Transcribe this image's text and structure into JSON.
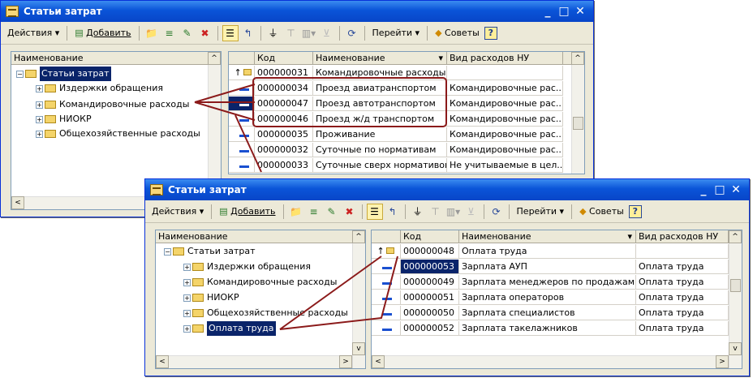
{
  "window1": {
    "title": "Статьи затрат",
    "toolbar": {
      "actions": "Действия",
      "add": "Добавить",
      "goto": "Перейти",
      "tips": "Советы",
      "help": "?"
    },
    "tree": {
      "header": "Наименование",
      "root": "Статьи затрат",
      "items": [
        "Издержки обращения",
        "Командировочные расходы",
        "НИОКР",
        "Общехозяйственные расходы"
      ]
    },
    "grid": {
      "headers": [
        "Код",
        "Наименование",
        "Вид расходов НУ"
      ],
      "parent": {
        "code": "000000031",
        "name": "Командировочные расходы"
      },
      "rows": [
        {
          "code": "000000034",
          "name": "Проезд авиатранспортом",
          "kind": "Командировочные рас..."
        },
        {
          "code": "000000047",
          "name": "Проезд автотранспортом",
          "kind": "Командировочные рас..."
        },
        {
          "code": "000000046",
          "name": "Проезд ж/д транспортом",
          "kind": "Командировочные рас..."
        },
        {
          "code": "000000035",
          "name": "Проживание",
          "kind": "Командировочные рас..."
        },
        {
          "code": "000000032",
          "name": "Суточные по нормативам",
          "kind": "Командировочные рас..."
        },
        {
          "code": "000000033",
          "name": "Суточные сверх нормативов",
          "kind": "Не учитываемые в цел..."
        }
      ]
    }
  },
  "window2": {
    "title": "Статьи затрат",
    "toolbar": {
      "actions": "Действия",
      "add": "Добавить",
      "goto": "Перейти",
      "tips": "Советы",
      "help": "?"
    },
    "tree": {
      "header": "Наименование",
      "root": "Статьи затрат",
      "items": [
        "Издержки обращения",
        "Командировочные расходы",
        "НИОКР",
        "Общехозяйственные расходы",
        "Оплата труда"
      ]
    },
    "grid": {
      "headers": [
        "Код",
        "Наименование",
        "Вид расходов НУ"
      ],
      "parent": {
        "code": "000000048",
        "name": "Оплата труда"
      },
      "rows": [
        {
          "code": "000000053",
          "name": "Зарплата АУП",
          "kind": "Оплата труда"
        },
        {
          "code": "000000049",
          "name": "Зарплата менеджеров по продажам",
          "kind": "Оплата труда"
        },
        {
          "code": "000000051",
          "name": "Зарплата операторов",
          "kind": "Оплата труда"
        },
        {
          "code": "000000050",
          "name": "Зарплата специалистов",
          "kind": "Оплата труда"
        },
        {
          "code": "000000052",
          "name": "Зарплата такелажников",
          "kind": "Оплата труда"
        }
      ]
    }
  },
  "colors": {
    "callout": "#8b1a1a",
    "selection": "#0a246a",
    "titlebar": "#0a54d8"
  }
}
